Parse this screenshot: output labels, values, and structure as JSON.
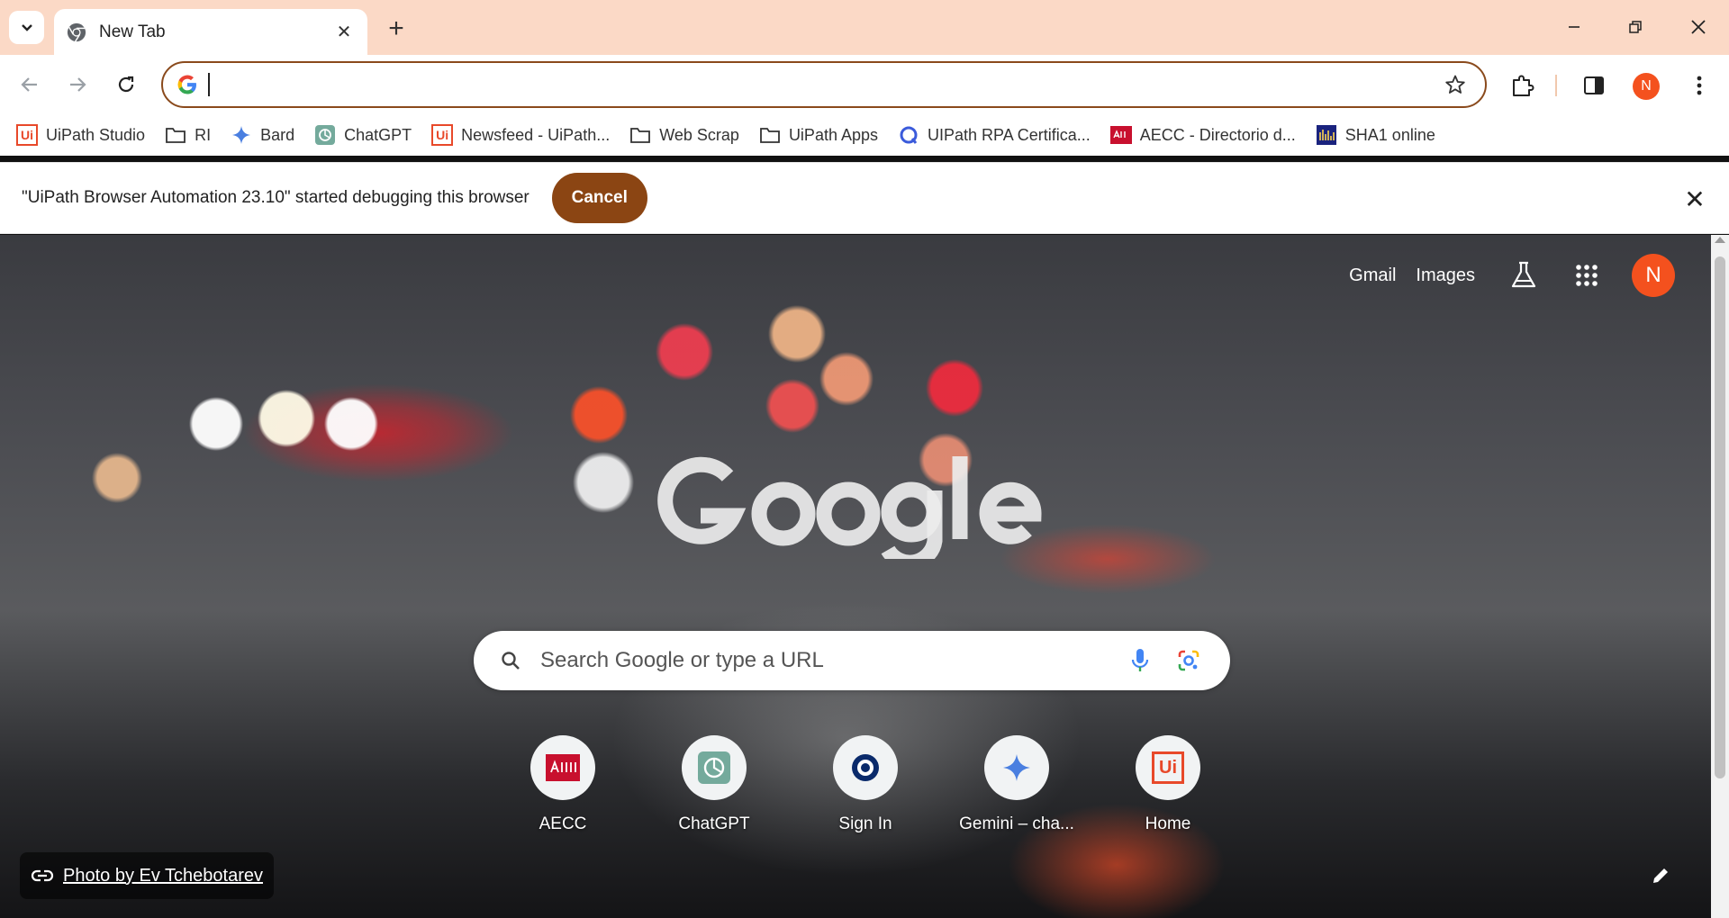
{
  "browser": {
    "tab": {
      "title": "New Tab",
      "close": "✕"
    },
    "new_tab": "+",
    "window": {
      "minimize": "—",
      "restore": "❐",
      "close": "✕"
    }
  },
  "toolbar": {
    "omnibox_value": "",
    "profile_initial": "N"
  },
  "bookmarks": [
    {
      "label": "UiPath Studio",
      "icon": "uipath-icon"
    },
    {
      "label": "RI",
      "icon": "folder-icon"
    },
    {
      "label": "Bard",
      "icon": "bard-icon"
    },
    {
      "label": "ChatGPT",
      "icon": "chatgpt-icon"
    },
    {
      "label": "Newsfeed - UiPath...",
      "icon": "uipath-icon"
    },
    {
      "label": "Web Scrap",
      "icon": "folder-icon"
    },
    {
      "label": "UiPath Apps",
      "icon": "folder-icon"
    },
    {
      "label": "UIPath RPA Certifica...",
      "icon": "certification-icon"
    },
    {
      "label": "AECC - Directorio d...",
      "icon": "aecc-icon"
    },
    {
      "label": "SHA1 online",
      "icon": "sha1-icon"
    }
  ],
  "infobar": {
    "message": "\"UiPath Browser Automation 23.10\" started debugging this browser",
    "cancel_label": "Cancel",
    "close": "✕"
  },
  "ntp": {
    "gmail": "Gmail",
    "images": "Images",
    "avatar_initial": "N",
    "search_placeholder": "Search Google or type a URL",
    "shortcuts": [
      {
        "label": "AECC",
        "icon": "aecc-icon"
      },
      {
        "label": "ChatGPT",
        "icon": "chatgpt-icon"
      },
      {
        "label": "Sign In",
        "icon": "sign-in-icon"
      },
      {
        "label": "Gemini – cha...",
        "icon": "gemini-icon"
      },
      {
        "label": "Home",
        "icon": "uipath-icon"
      }
    ],
    "photo_credit": "Photo by Ev Tchebotarev"
  },
  "colors": {
    "tabstrip": "#fbd9c6",
    "accent": "#8b4513",
    "profile": "#f4511e"
  }
}
